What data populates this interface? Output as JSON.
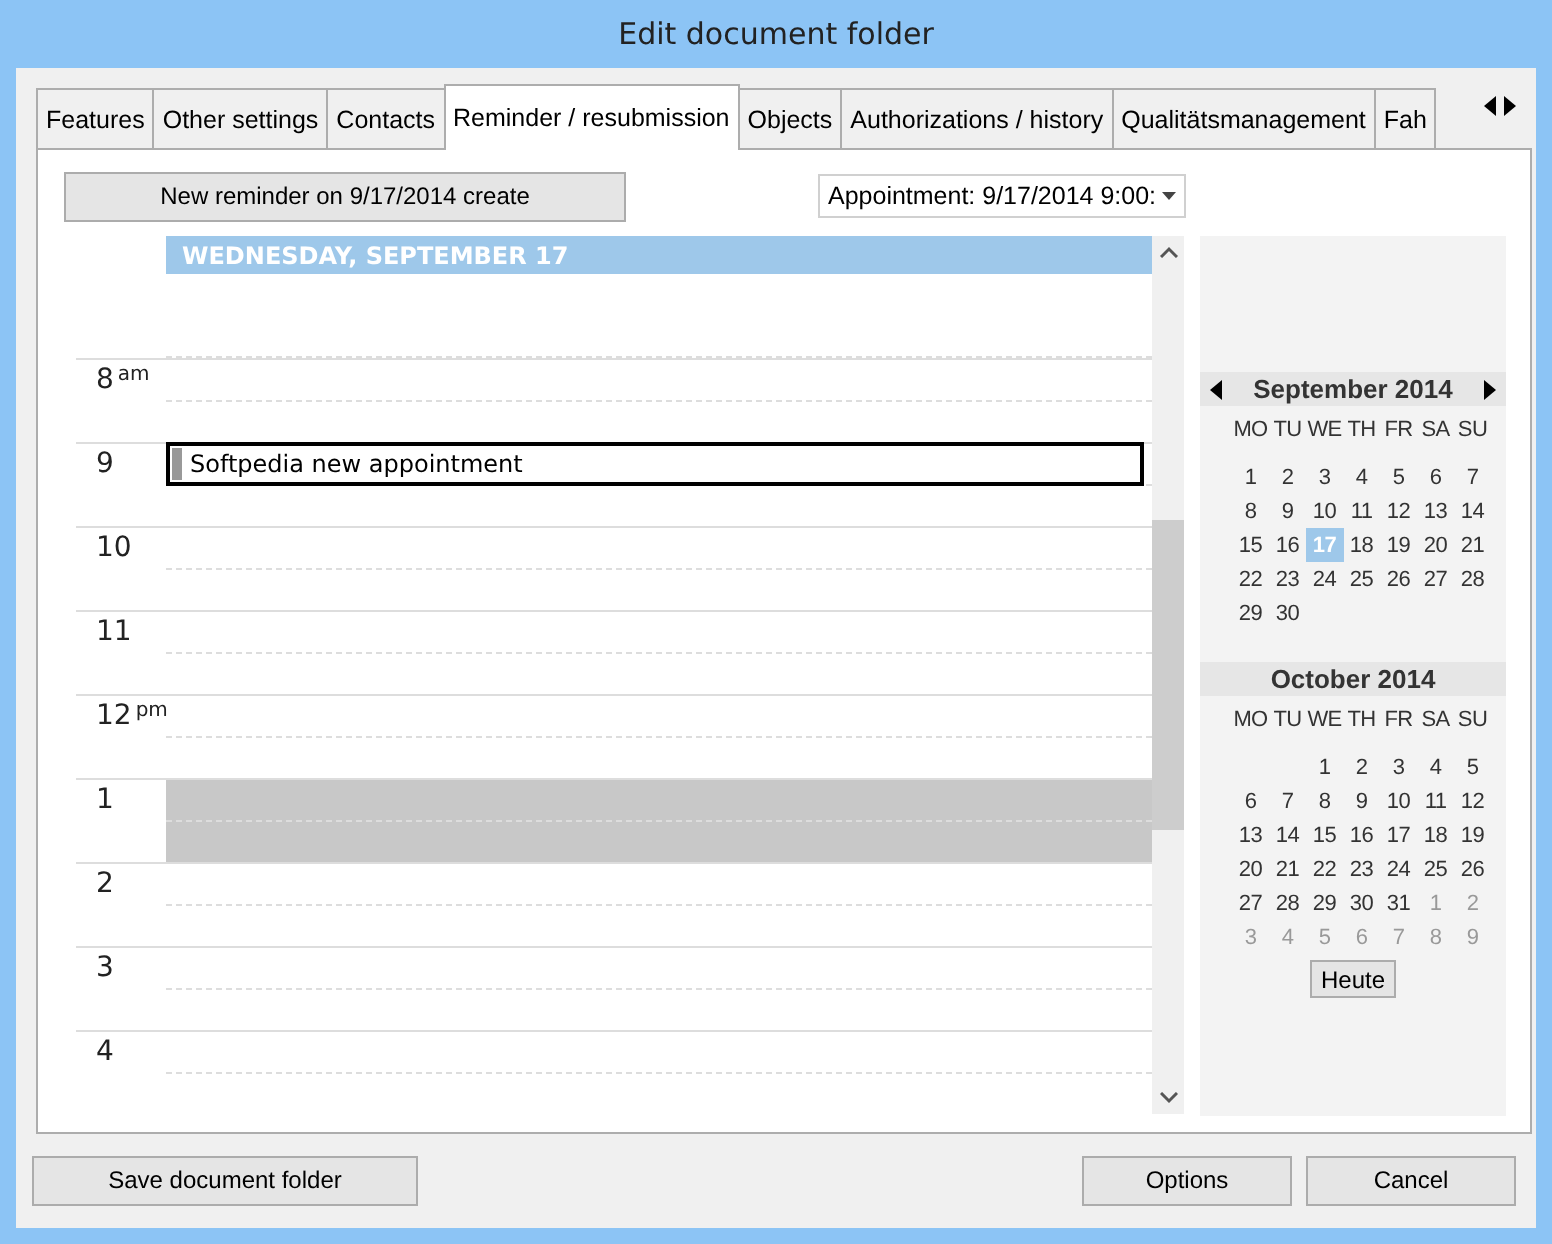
{
  "window": {
    "title": "Edit document folder"
  },
  "tabs": [
    {
      "label": "Features",
      "selected": false
    },
    {
      "label": "Other settings",
      "selected": false
    },
    {
      "label": "Contacts",
      "selected": false
    },
    {
      "label": "Reminder / resubmission",
      "selected": true
    },
    {
      "label": "Objects",
      "selected": false
    },
    {
      "label": "Authorizations / history",
      "selected": false
    },
    {
      "label": "Qualitätsmanagement",
      "selected": false
    },
    {
      "label": "Fah",
      "selected": false
    }
  ],
  "new_reminder_button": "New reminder on 9/17/2014 create",
  "appointment_dropdown": {
    "value": "Appointment: 9/17/2014 9:00:"
  },
  "day_view": {
    "header": "WEDNESDAY, SEPTEMBER 17",
    "hours": [
      {
        "label": "8",
        "suffix": "am",
        "blocked": false
      },
      {
        "label": "9",
        "blocked": false,
        "appointment": "Softpedia new appointment"
      },
      {
        "label": "10",
        "blocked": false
      },
      {
        "label": "11",
        "blocked": false
      },
      {
        "label": "12",
        "suffix": "pm",
        "blocked": false
      },
      {
        "label": "1",
        "blocked": true
      },
      {
        "label": "2",
        "blocked": false
      },
      {
        "label": "3",
        "blocked": false
      },
      {
        "label": "4",
        "blocked": false
      }
    ]
  },
  "calendar": {
    "months": [
      {
        "title": "September 2014",
        "nav": true,
        "weekdays": [
          "MO",
          "TU",
          "WE",
          "TH",
          "FR",
          "SA",
          "SU"
        ],
        "weeks": [
          [
            {
              "kind": "day",
              "day": "1",
              "selected": false,
              "faded": false
            },
            {
              "kind": "day",
              "day": "2",
              "selected": false,
              "faded": false
            },
            {
              "kind": "day",
              "day": "3",
              "selected": false,
              "faded": false
            },
            {
              "kind": "day",
              "day": "4",
              "selected": false,
              "faded": false
            },
            {
              "kind": "day",
              "day": "5",
              "selected": false,
              "faded": false
            },
            {
              "kind": "day",
              "day": "6",
              "selected": false,
              "faded": false
            },
            {
              "kind": "day",
              "day": "7",
              "selected": false,
              "faded": false
            }
          ],
          [
            {
              "kind": "day",
              "day": "8",
              "selected": false,
              "faded": false
            },
            {
              "kind": "day",
              "day": "9",
              "selected": false,
              "faded": false
            },
            {
              "kind": "day",
              "day": "10",
              "selected": false,
              "faded": false
            },
            {
              "kind": "day",
              "day": "11",
              "selected": false,
              "faded": false
            },
            {
              "kind": "day",
              "day": "12",
              "selected": false,
              "faded": false
            },
            {
              "kind": "day",
              "day": "13",
              "selected": false,
              "faded": false
            },
            {
              "kind": "day",
              "day": "14",
              "selected": false,
              "faded": false
            }
          ],
          [
            {
              "kind": "day",
              "day": "15",
              "selected": false,
              "faded": false
            },
            {
              "kind": "day",
              "day": "16",
              "selected": false,
              "faded": false
            },
            {
              "kind": "day",
              "day": "17",
              "selected": true,
              "faded": false
            },
            {
              "kind": "day",
              "day": "18",
              "selected": false,
              "faded": false
            },
            {
              "kind": "day",
              "day": "19",
              "selected": false,
              "faded": false
            },
            {
              "kind": "day",
              "day": "20",
              "selected": false,
              "faded": false
            },
            {
              "kind": "day",
              "day": "21",
              "selected": false,
              "faded": false
            }
          ],
          [
            {
              "kind": "day",
              "day": "22",
              "selected": false,
              "faded": false
            },
            {
              "kind": "day",
              "day": "23",
              "selected": false,
              "faded": false
            },
            {
              "kind": "day",
              "day": "24",
              "selected": false,
              "faded": false
            },
            {
              "kind": "day",
              "day": "25",
              "selected": false,
              "faded": false
            },
            {
              "kind": "day",
              "day": "26",
              "selected": false,
              "faded": false
            },
            {
              "kind": "day",
              "day": "27",
              "selected": false,
              "faded": false
            },
            {
              "kind": "day",
              "day": "28",
              "selected": false,
              "faded": false
            }
          ],
          [
            {
              "kind": "day",
              "day": "29",
              "selected": false,
              "faded": false
            },
            {
              "kind": "day",
              "day": "30",
              "selected": false,
              "faded": false
            }
          ]
        ]
      },
      {
        "title": "October 2014",
        "nav": false,
        "weekdays": [
          "MO",
          "TU",
          "WE",
          "TH",
          "FR",
          "SA",
          "SU"
        ],
        "weeks": [
          [
            {
              "kind": "blank"
            },
            {
              "kind": "blank"
            },
            {
              "kind": "day",
              "day": "1",
              "selected": false,
              "faded": false
            },
            {
              "kind": "day",
              "day": "2",
              "selected": false,
              "faded": false
            },
            {
              "kind": "day",
              "day": "3",
              "selected": false,
              "faded": false
            },
            {
              "kind": "day",
              "day": "4",
              "selected": false,
              "faded": false
            },
            {
              "kind": "day",
              "day": "5",
              "selected": false,
              "faded": false
            }
          ],
          [
            {
              "kind": "day",
              "day": "6",
              "selected": false,
              "faded": false
            },
            {
              "kind": "day",
              "day": "7",
              "selected": false,
              "faded": false
            },
            {
              "kind": "day",
              "day": "8",
              "selected": false,
              "faded": false
            },
            {
              "kind": "day",
              "day": "9",
              "selected": false,
              "faded": false
            },
            {
              "kind": "day",
              "day": "10",
              "selected": false,
              "faded": false
            },
            {
              "kind": "day",
              "day": "11",
              "selected": false,
              "faded": false
            },
            {
              "kind": "day",
              "day": "12",
              "selected": false,
              "faded": false
            }
          ],
          [
            {
              "kind": "day",
              "day": "13",
              "selected": false,
              "faded": false
            },
            {
              "kind": "day",
              "day": "14",
              "selected": false,
              "faded": false
            },
            {
              "kind": "day",
              "day": "15",
              "selected": false,
              "faded": false
            },
            {
              "kind": "day",
              "day": "16",
              "selected": false,
              "faded": false
            },
            {
              "kind": "day",
              "day": "17",
              "selected": false,
              "faded": false
            },
            {
              "kind": "day",
              "day": "18",
              "selected": false,
              "faded": false
            },
            {
              "kind": "day",
              "day": "19",
              "selected": false,
              "faded": false
            }
          ],
          [
            {
              "kind": "day",
              "day": "20",
              "selected": false,
              "faded": false
            },
            {
              "kind": "day",
              "day": "21",
              "selected": false,
              "faded": false
            },
            {
              "kind": "day",
              "day": "22",
              "selected": false,
              "faded": false
            },
            {
              "kind": "day",
              "day": "23",
              "selected": false,
              "faded": false
            },
            {
              "kind": "day",
              "day": "24",
              "selected": false,
              "faded": false
            },
            {
              "kind": "day",
              "day": "25",
              "selected": false,
              "faded": false
            },
            {
              "kind": "day",
              "day": "26",
              "selected": false,
              "faded": false
            }
          ],
          [
            {
              "kind": "day",
              "day": "27",
              "selected": false,
              "faded": false
            },
            {
              "kind": "day",
              "day": "28",
              "selected": false,
              "faded": false
            },
            {
              "kind": "day",
              "day": "29",
              "selected": false,
              "faded": false
            },
            {
              "kind": "day",
              "day": "30",
              "selected": false,
              "faded": false
            },
            {
              "kind": "day",
              "day": "31",
              "selected": false,
              "faded": false
            },
            {
              "kind": "day",
              "day": "1",
              "selected": false,
              "faded": true
            },
            {
              "kind": "day",
              "day": "2",
              "selected": false,
              "faded": true
            }
          ],
          [
            {
              "kind": "day",
              "day": "3",
              "selected": false,
              "faded": true
            },
            {
              "kind": "day",
              "day": "4",
              "selected": false,
              "faded": true
            },
            {
              "kind": "day",
              "day": "5",
              "selected": false,
              "faded": true
            },
            {
              "kind": "day",
              "day": "6",
              "selected": false,
              "faded": true
            },
            {
              "kind": "day",
              "day": "7",
              "selected": false,
              "faded": true
            },
            {
              "kind": "day",
              "day": "8",
              "selected": false,
              "faded": true
            },
            {
              "kind": "day",
              "day": "9",
              "selected": false,
              "faded": true
            }
          ]
        ]
      }
    ],
    "today_button": "Heute"
  },
  "buttons": {
    "save": "Save document folder",
    "options": "Options",
    "cancel": "Cancel"
  }
}
